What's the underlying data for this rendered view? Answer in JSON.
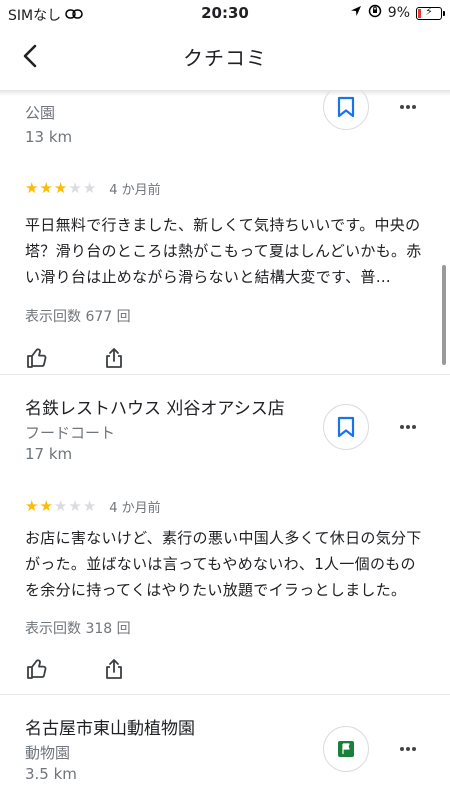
{
  "status_bar": {
    "carrier": "SIMなし",
    "time": "20:30",
    "battery": "9%",
    "battery_level": 0.09
  },
  "nav": {
    "title": "クチコミ"
  },
  "reviews": [
    {
      "name": "",
      "type": "公園",
      "distance": "13 km",
      "rating": 3,
      "time_ago": "4 か月前",
      "text": "平日無料で行きました、新しくて気持ちいいです。中央の塔？滑り台のところは熱がこもって夏はしんどいかも。赤い滑り台は止めながら滑らないと結構大変です、普…",
      "views": "表示回数 677 回",
      "saved_state": "bookmark-outline"
    },
    {
      "name": "名鉄レストハウス 刈谷オアシス店",
      "type": "フードコート",
      "distance": "17 km",
      "rating": 2,
      "time_ago": "4 か月前",
      "text": "お店に害ないけど、素行の悪い中国人多くて休日の気分下がった。並ばないは言ってもやめないわ、1人一個のものを余分に持ってくはやりたい放題でイラっとしました。",
      "views": "表示回数 318 回",
      "saved_state": "bookmark-outline"
    },
    {
      "name": "名古屋市東山動植物園",
      "type": "動物園",
      "distance": "3.5 km",
      "saved_state": "flag-green"
    }
  ],
  "colors": {
    "star_on": "#fbbc04",
    "star_off": "#dadce0",
    "bookmark_blue": "#1a73e8",
    "flag_green": "#188038"
  }
}
